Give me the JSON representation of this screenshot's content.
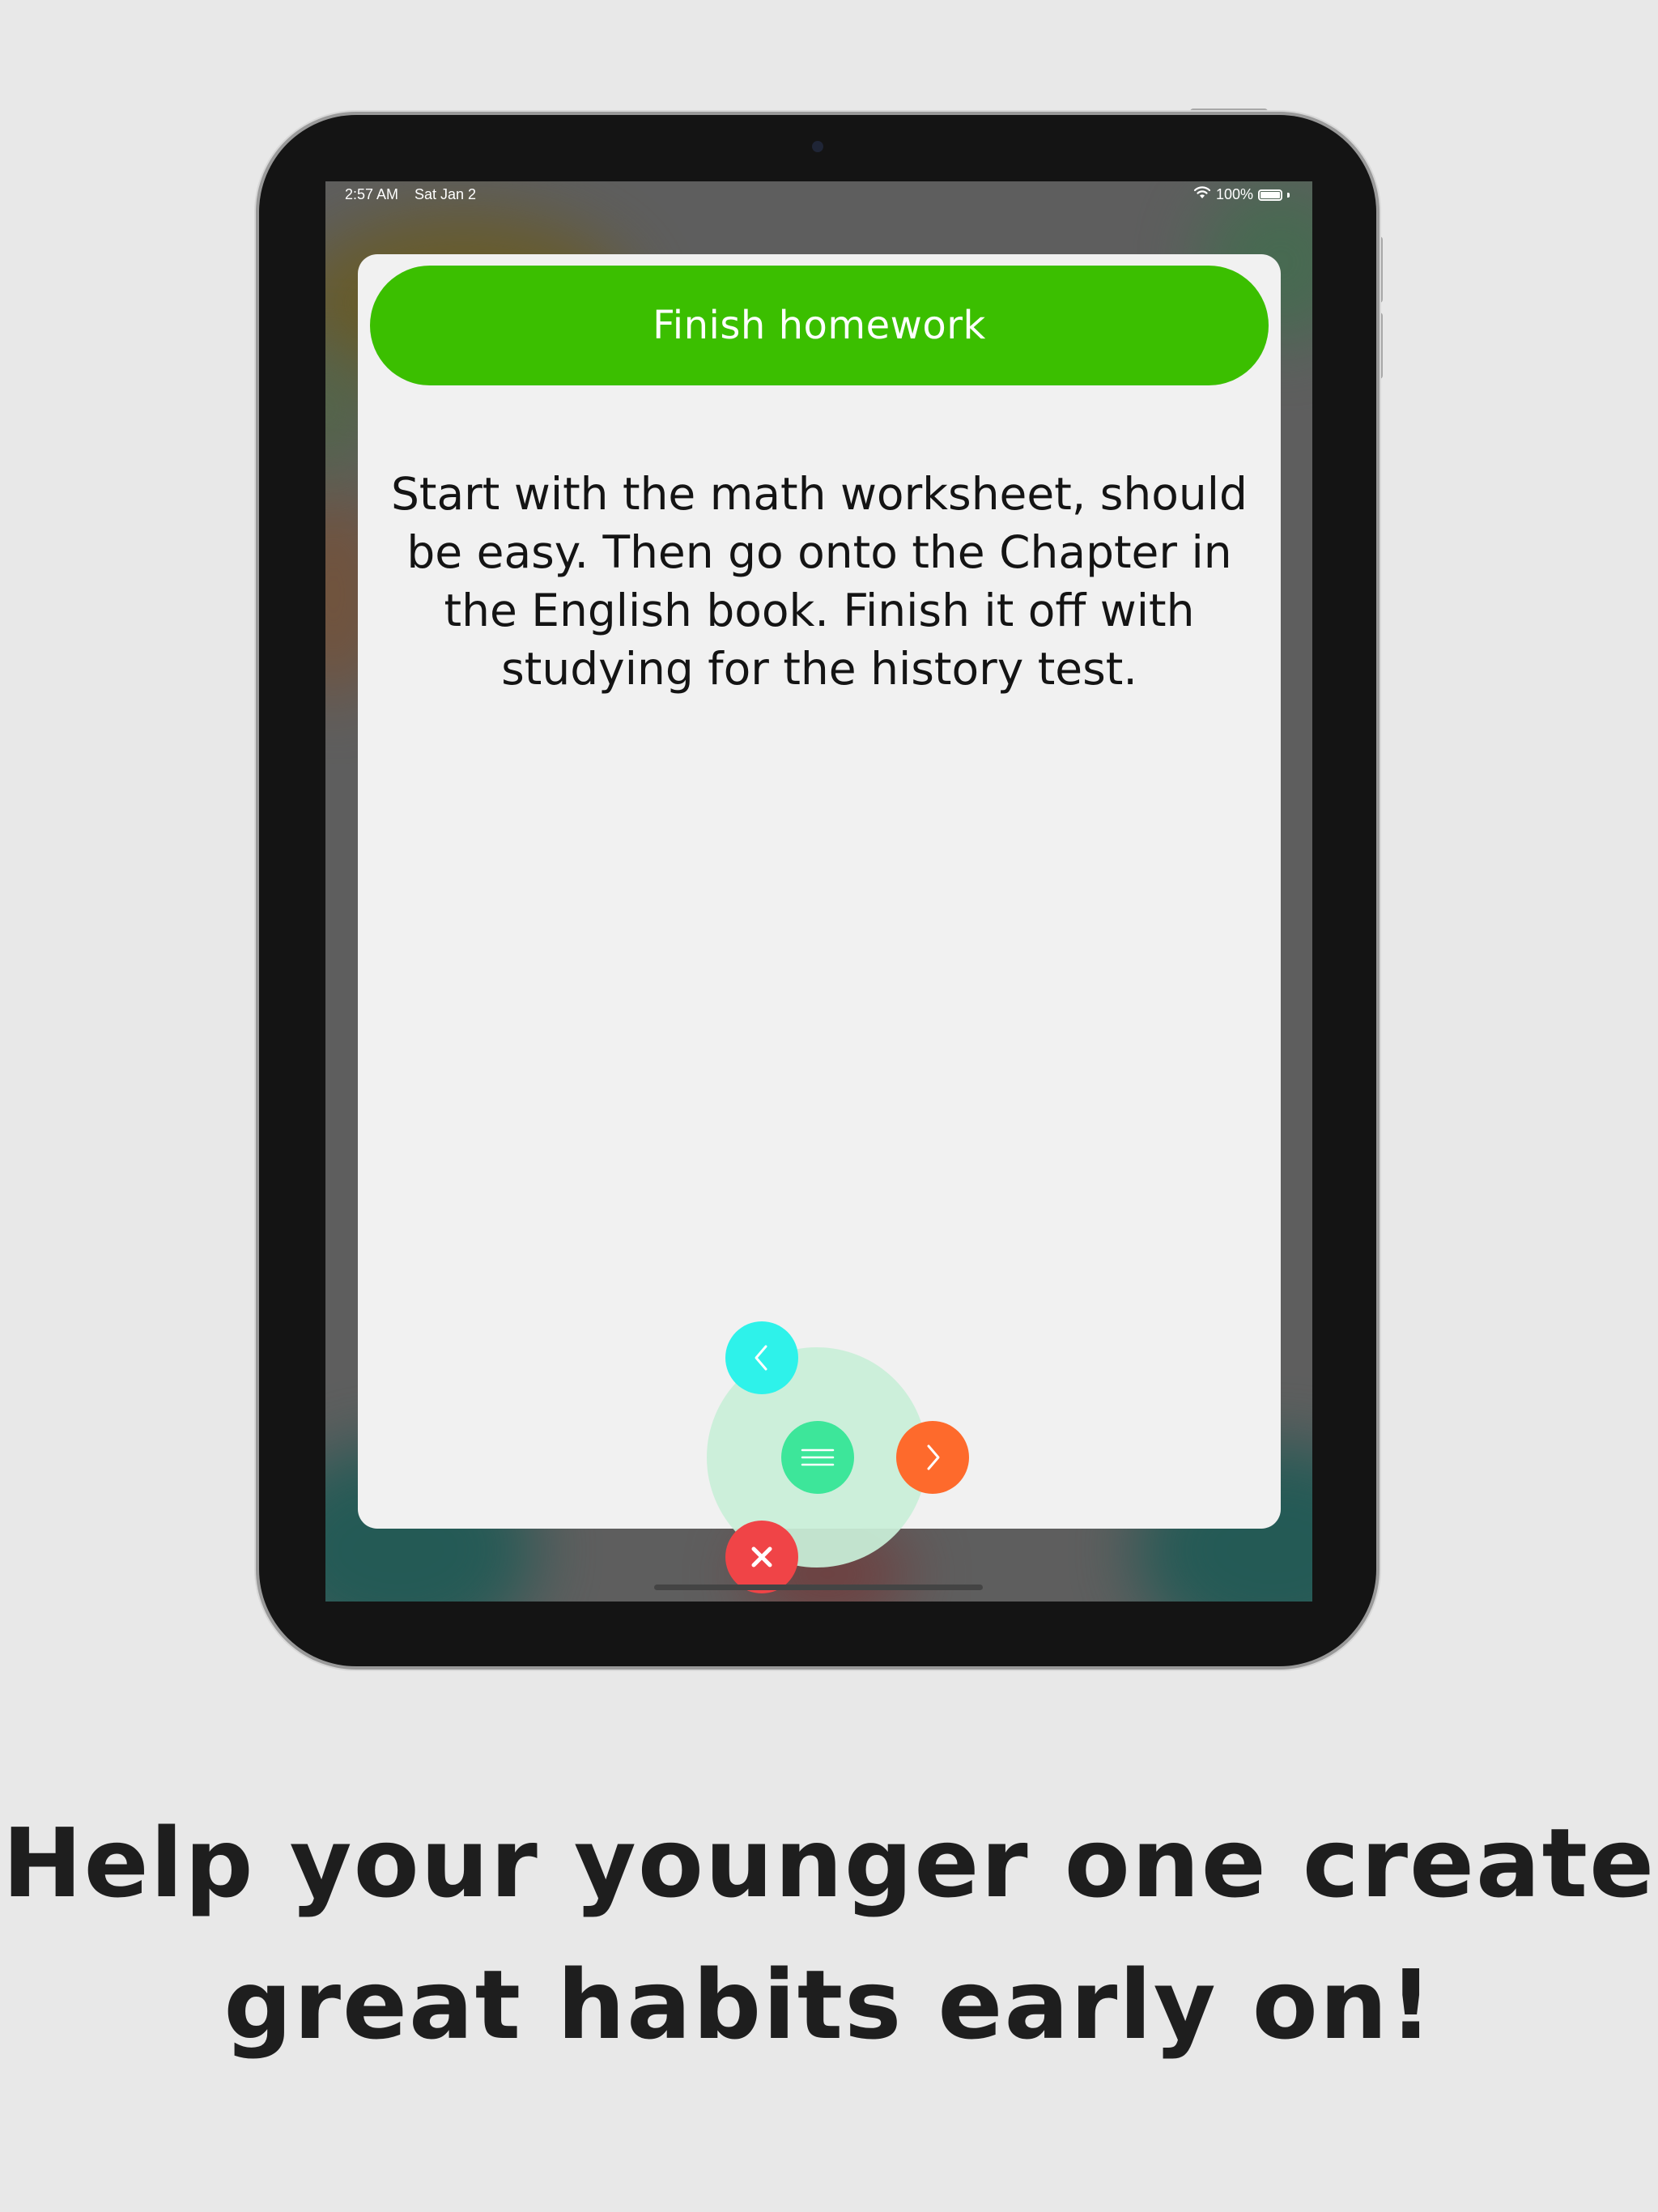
{
  "status_bar": {
    "time": "2:57 AM",
    "date": "Sat Jan 2",
    "battery": "100%"
  },
  "task": {
    "title": "Finish homework",
    "description": "Start with the math worksheet, should be easy. Then go onto the Chapter in the English book. Finish it off with studying for the history test."
  },
  "fab_menu": {
    "back_icon": "chevron-left-icon",
    "menu_icon": "hamburger-menu-icon",
    "next_icon": "chevron-right-icon",
    "close_icon": "close-icon"
  },
  "caption": {
    "line1": "Help your younger one create",
    "line2": "great habits early on!"
  },
  "colors": {
    "title_pill": "#3bbf00",
    "back_button": "#2ef2ea",
    "menu_button": "#3de69a",
    "next_button": "#fe6a2c",
    "close_button": "#f04447",
    "page_background": "#e8e8e8"
  }
}
